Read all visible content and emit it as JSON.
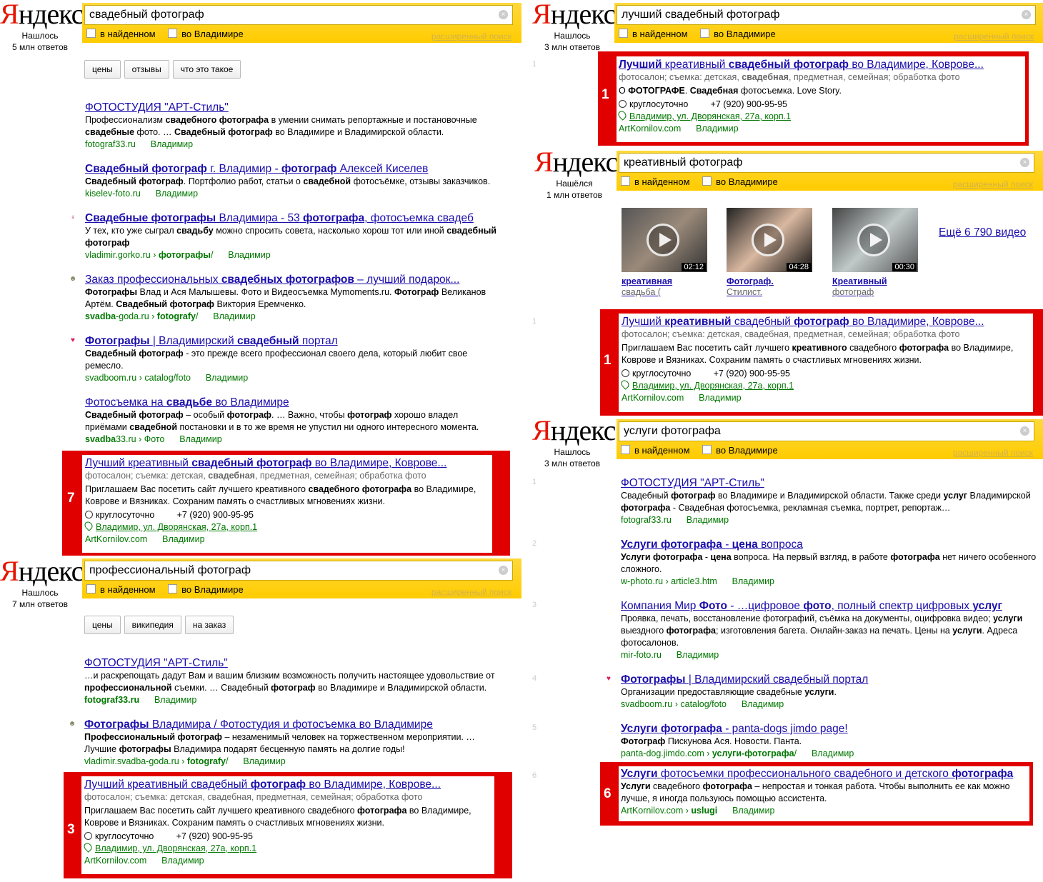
{
  "colors": {
    "accent_red": "#e00000",
    "link": "#1a0dab",
    "url_green": "#007700",
    "yandex_yellow": "#ffcc00"
  },
  "logo": {
    "y": "Я",
    "rest": "ндекс"
  },
  "advanced": "расширенный поиск",
  "opt_found": "в найденном",
  "opt_city": "во Владимире",
  "maps_addr": "Владимир, ул. Дворянская, 27а, корп.1",
  "hours": "круглосуточно",
  "phone": "+7 (920) 900-95-95",
  "art_url": "ArtKornilov.com",
  "city": "Владимир",
  "p1": {
    "query": "свадебный фотограф",
    "found1": "Нашлось",
    "found2": "5 млн ответов",
    "chips": [
      "цены",
      "отзывы",
      "что это такое"
    ],
    "results": [
      {
        "title_pre": "ФОТОСТУДИЯ \"АРТ-Стиль\"",
        "s1": "Профессионализм",
        "s1b": "свадебного фотографа",
        "s1c": "в умении снимать репортажные и постановочные",
        "s2": "свадебные",
        "s2b": "фото. …",
        "s2c": "Свадебный фотограф",
        "s2d": "во Владимире и Владимирской области.",
        "url": "fotograf33.ru"
      },
      {
        "title_a": "Свадебный фотограф",
        "title_b": "г. Владимир -",
        "title_c": "фотограф",
        "title_d": "Алексей Киселев",
        "s1a": "Свадебный фотограф",
        "s1b": ". Портфолио работ, статьи о",
        "s1c": "свадебной",
        "s1d": "фотосъёмке, отзывы заказчиков.",
        "url": "kiselev-foto.ru"
      },
      {
        "title_a": "Свадебные фотографы",
        "title_b": "Владимира - 53",
        "title_c": "фотографа",
        "title_d": ", фотосъемка свадеб",
        "s1": "У тех, кто уже сыграл",
        "s1b": "свадьбу",
        "s1c": "можно спросить совета, насколько хорош тот или иной",
        "s1d": "свадебный",
        "s2": "фотограф",
        "url": "vladimir.gorko.ru",
        "url2": "фотографы",
        "sep": "›",
        "slash": "/"
      },
      {
        "title_a": "Заказ профессиональных",
        "title_b": "свадебных фотографов",
        "title_c": "– лучший подарок...",
        "s1a": "Фотографы",
        "s1b": "Влад и Ася Малышевы. Фото и Видеосъемка Mymoments.ru.",
        "s1c": "Фотограф",
        "s1d": "Великанов",
        "s2a": "Артём.",
        "s2b": "Свадебный фотограф",
        "s2c": "Виктория Еремченко.",
        "url_a": "svadba",
        "url_b": "-goda.ru ›",
        "url_c": "fotografy",
        "slash": "/"
      },
      {
        "title_a": "Фотографы",
        "title_b": "| Владимирский",
        "title_c": "свадебный",
        "title_d": "портал",
        "s1a": "Свадебный фотограф",
        "s1b": "- это прежде всего профессионал своего дела, который любит свое",
        "s2": "ремесло.",
        "url": "svadboom.ru › catalog/foto"
      },
      {
        "title_a": "Фотосъемка на",
        "title_b": "свадьбе",
        "title_c": "во Владимире",
        "s1a": "Свадебный фотограф",
        "s1b": "– особый",
        "s1c": "фотограф",
        "s1d": ". … Важно, чтобы",
        "s1e": "фотограф",
        "s1f": "хорошо владел",
        "s2a": "приёмами",
        "s2b": "свадебной",
        "s2c": "постановки и в то же время не упустил ни одного интересного момента.",
        "url_a": "svadba",
        "url_b": "33.ru › Фото"
      }
    ],
    "ad": {
      "rank": "7",
      "title_a": "Лучший креативный",
      "title_b": "свадебный фотограф",
      "title_c": "во Владимире, Коврове...",
      "meta_a": "фотосалон; съемка: детская,",
      "meta_b": "свадебная",
      "meta_c": ", предметная, семейная; обработка фото",
      "s1a": "Приглашаем Вас посетить сайт лучшего креативного",
      "s1b": "свадебного фотографа",
      "s1c": "во Владимире,",
      "s2": "Коврове и Вязниках. Сохраним память о счастливых мгновениях жизни."
    }
  },
  "p2": {
    "query": "профессиональный фотограф",
    "found1": "Нашлось",
    "found2": "7 млн ответов",
    "chips": [
      "цены",
      "википедия",
      "на заказ"
    ],
    "r1": {
      "title": "ФОТОСТУДИЯ \"АРТ-Стиль\"",
      "s1": "…и раскрепощать дадут Вам и вашим близким возможность получить настоящее удовольствие от",
      "s2a": "профессиональной",
      "s2b": "съемки. … Свадебный",
      "s2c": "фотограф",
      "s2d": "во Владимире и Владимирской области.",
      "url": "fotograf33.ru"
    },
    "r2": {
      "title_a": "Фотографы",
      "title_b": "Владимира / Фотостудия и фотосъемка во Владимире",
      "s1a": "Профессиональный фотограф",
      "s1b": "– незаменимый человек на торжественном мероприятии. …",
      "s2a": "Лучшие",
      "s2b": "фотографы",
      "s2c": "Владимира подарят бесценную память на долгие годы!",
      "url_a": "vladimir.svadba-goda.ru ›",
      "url_b": "fotografy",
      "slash": "/"
    },
    "ad": {
      "rank": "3",
      "title_a": "Лучший креативный свадебный",
      "title_b": "фотограф",
      "title_c": "во Владимире, Коврове...",
      "meta": "фотосалон; съемка: детская, свадебная, предметная, семейная; обработка фото",
      "s1a": "Приглашаем Вас посетить сайт лучшего креативного свадебного",
      "s1b": "фотографа",
      "s1c": "во Владимире,",
      "s2": "Коврове и Вязниках. Сохраним память о счастливых мгновениях жизни."
    }
  },
  "p3": {
    "query": "лучший свадебный фотограф",
    "found1": "Нашлось",
    "found2": "3 млн ответов",
    "ad": {
      "rank": "1",
      "num": "1",
      "title_a": "Лучший",
      "title_b": "креативный",
      "title_c": "свадебный фотограф",
      "title_d": "во Владимире, Коврове...",
      "meta_a": "фотосалон; съемка: детская,",
      "meta_b": "свадебная",
      "meta_c": ", предметная, семейная; обработка фото",
      "s1a": "О",
      "s1b": "ФОТОГРАФЕ",
      "s1c": ".",
      "s1d": "Свадебная",
      "s1e": "фотосъемка. Love Story."
    }
  },
  "p4": {
    "query": "креативный фотограф",
    "found1": "Нашёлся",
    "found2": "1 млн ответов",
    "videos": [
      {
        "dur": "02:12",
        "cap": "креативная",
        "sub": "свадьба ("
      },
      {
        "dur": "04:28",
        "cap": "Фотограф.",
        "sub": "Стилист."
      },
      {
        "dur": "00:30",
        "cap": "Креативный",
        "sub": "фотограф"
      }
    ],
    "more": "Ещё 6 790 видео",
    "ad": {
      "rank": "1",
      "num": "1",
      "title_a": "Лучший",
      "title_b": "креативный",
      "title_c": "свадебный",
      "title_d": "фотограф",
      "title_e": "во Владимире, Коврове...",
      "meta": "фотосалон; съемка: детская, свадебная, предметная, семейная; обработка фото",
      "s1a": "Приглашаем Вас посетить сайт лучшего",
      "s1b": "креативного",
      "s1c": "свадебного",
      "s1d": "фотографа",
      "s1e": "во Владимире,",
      "s2": "Коврове и Вязниках. Сохраним память о счастливых мгновениях жизни."
    }
  },
  "p5": {
    "query": "услуги фотографа",
    "found1": "Нашлось",
    "found2": "3 млн ответов",
    "nums": [
      "1",
      "2",
      "3",
      "4",
      "5",
      "6"
    ],
    "r1": {
      "title": "ФОТОСТУДИЯ \"АРТ-Стиль\"",
      "s1a": "Свадебный",
      "s1b": "фотограф",
      "s1c": "во Владимире и Владимирской области. Также среди",
      "s1d": "услуг",
      "s1e": "Владимирской",
      "s2a": "фотографа",
      "s2b": "- Свадебная фотосъемка, рекламная съемка, портрет, репортаж…",
      "url": "fotograf33.ru"
    },
    "r2": {
      "title_a": "Услуги фотографа",
      "title_b": "-",
      "title_c": "цена",
      "title_d": "вопроса",
      "s1a": "Услуги фотографа",
      "s1b": "-",
      "s1c": "цена",
      "s1d": "вопроса. На первый взгляд, в работе",
      "s1e": "фотографа",
      "s1f": "нет ничего особенного",
      "s2": "сложного.",
      "url": "w-photo.ru › article3.htm"
    },
    "r3": {
      "title_a": "Компания Мир",
      "title_b": "Фото",
      "title_c": "- …цифровое",
      "title_d": "фото",
      "title_e": ", полный спектр цифровых",
      "title_f": "услуг",
      "s1a": "Проявка, печать, восстановление фотографий, съёмка на документы, оцифровка видео;",
      "s1b": "услуги",
      "s2a": "выездного",
      "s2b": "фотографа",
      "s2c": "; изготовления багета. Онлайн-заказ на печать. Цены на",
      "s2d": "услуги",
      "s2e": ". Адреса",
      "s3": "фотосалонов.",
      "url": "mir-foto.ru"
    },
    "r4": {
      "title_a": "Фотографы",
      "title_b": "| Владимирский свадебный портал",
      "s1a": "Организации предоставляющие свадебные",
      "s1b": "услуги",
      "s1c": ".",
      "url": "svadboom.ru › catalog/foto"
    },
    "r5": {
      "title_a": "Услуги фотографа",
      "title_b": "- panta-dogs jimdo page!",
      "s1a": "Фотограф",
      "s1b": "Пискунова Ася. Новости. Панта.",
      "url_a": "panta-dog.jimdo.com ›",
      "url_b": "услуги-фотографа",
      "slash": "/"
    },
    "ad": {
      "rank": "6",
      "title_a": "Услуги",
      "title_b": "фотосъемки профессионального свадебного и детского",
      "title_c": "фотографа",
      "s1a": "Услуги",
      "s1b": "свадебного",
      "s1c": "фотографа",
      "s1d": "– непростая и тонкая работа. Чтобы выполнить ее как можно",
      "s2": "лучше, я иногда пользуюсь помощью ассистента.",
      "url_a": "ArtKornilov.com ›",
      "url_b": "uslugi"
    }
  }
}
